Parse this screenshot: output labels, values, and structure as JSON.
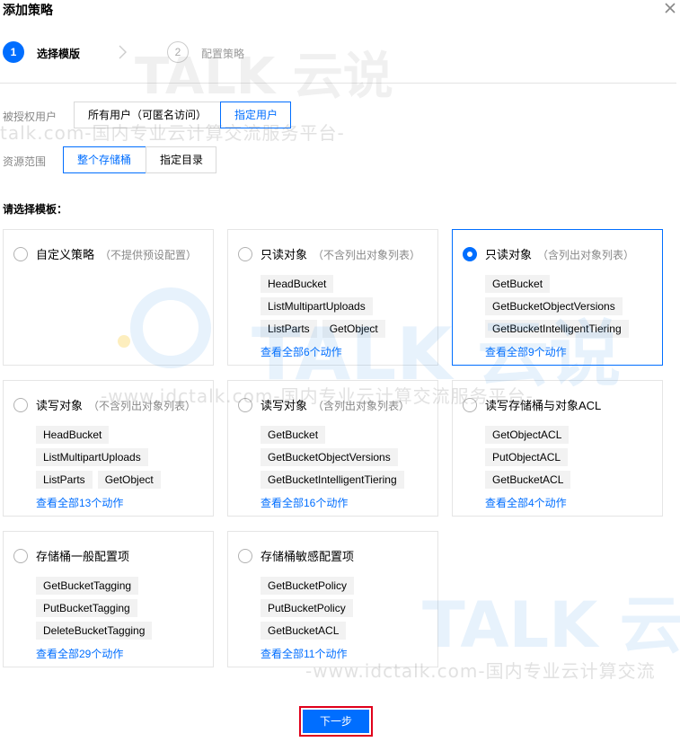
{
  "dialog": {
    "title": "添加策略",
    "close_icon": "close-icon"
  },
  "steps": [
    {
      "number": "1",
      "label": "选择模版",
      "active": true
    },
    {
      "number": "2",
      "label": "配置策略",
      "active": false
    }
  ],
  "authorized_user": {
    "label": "被授权用户",
    "options": [
      "所有用户（可匿名访问）",
      "指定用户"
    ],
    "selected": "指定用户"
  },
  "resource_scope": {
    "label": "资源范围",
    "options": [
      "整个存储桶",
      "指定目录"
    ],
    "selected": "整个存储桶"
  },
  "templates_title": "请选择模板：",
  "templates": [
    {
      "title": "自定义策略",
      "sub": "（不提供预设配置）",
      "tags": [],
      "view_all": "",
      "selected": false
    },
    {
      "title": "只读对象",
      "sub": "（不含列出对象列表）",
      "tags": [
        [
          "HeadBucket"
        ],
        [
          "ListMultipartUploads"
        ],
        [
          "ListParts",
          "GetObject"
        ]
      ],
      "view_all": "查看全部6个动作",
      "selected": false
    },
    {
      "title": "只读对象",
      "sub": "（含列出对象列表）",
      "tags": [
        [
          "GetBucket"
        ],
        [
          "GetBucketObjectVersions"
        ],
        [
          "GetBucketIntelligentTiering"
        ]
      ],
      "view_all": "查看全部9个动作",
      "selected": true
    },
    {
      "title": "读写对象",
      "sub": "（不含列出对象列表）",
      "tags": [
        [
          "HeadBucket"
        ],
        [
          "ListMultipartUploads"
        ],
        [
          "ListParts",
          "GetObject"
        ]
      ],
      "view_all": "查看全部13个动作",
      "selected": false
    },
    {
      "title": "读写对象",
      "sub": "（含列出对象列表）",
      "tags": [
        [
          "GetBucket"
        ],
        [
          "GetBucketObjectVersions"
        ],
        [
          "GetBucketIntelligentTiering"
        ]
      ],
      "view_all": "查看全部16个动作",
      "selected": false
    },
    {
      "title": "读写存储桶与对象ACL",
      "sub": "",
      "tags": [
        [
          "GetObjectACL"
        ],
        [
          "PutObjectACL"
        ],
        [
          "GetBucketACL"
        ]
      ],
      "view_all": "查看全部4个动作",
      "selected": false
    },
    {
      "title": "存储桶一般配置项",
      "sub": "",
      "tags": [
        [
          "GetBucketTagging"
        ],
        [
          "PutBucketTagging"
        ],
        [
          "DeleteBucketTagging"
        ]
      ],
      "view_all": "查看全部29个动作",
      "selected": false
    },
    {
      "title": "存储桶敏感配置项",
      "sub": "",
      "tags": [
        [
          "GetBucketPolicy"
        ],
        [
          "PutBucketPolicy"
        ],
        [
          "GetBucketACL"
        ]
      ],
      "view_all": "查看全部11个动作",
      "selected": false
    }
  ],
  "next_button": "下一步",
  "watermark": {
    "line1": "talk.com-国内专业云计算交流服务平台-",
    "line2": "-www.idctalk.com-国内专业云计算交流服务平台-",
    "line3": "-www.idctalk.com-国内专业云计算交流",
    "brand": "TALK 云说"
  },
  "colors": {
    "accent": "#006eff",
    "highlight_border": "#e0001b",
    "tag_bg": "#f2f2f2"
  }
}
